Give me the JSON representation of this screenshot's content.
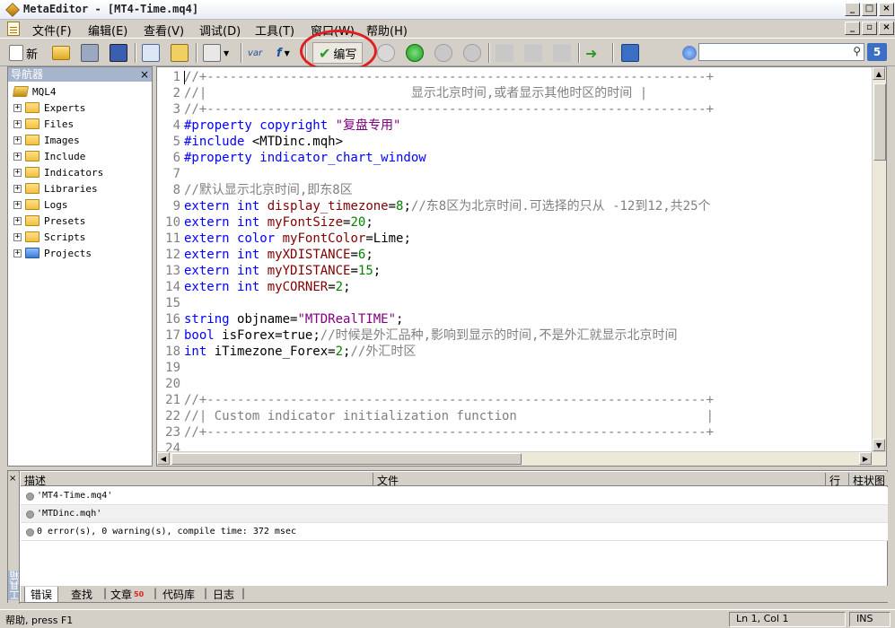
{
  "window": {
    "title": "MetaEditor - [MT4-Time.mq4]"
  },
  "menu": [
    "文件(F)",
    "编辑(E)",
    "查看(V)",
    "调试(D)",
    "工具(T)",
    "窗口(W)",
    "帮助(H)"
  ],
  "toolbar": {
    "new_label": "新",
    "compile_label": "编写",
    "var_label": "var",
    "f_label": "f",
    "search_badge": "5"
  },
  "navigator": {
    "title": "导航器",
    "root": "MQL4",
    "items": [
      "Experts",
      "Files",
      "Images",
      "Include",
      "Indicators",
      "Libraries",
      "Logs",
      "Presets",
      "Scripts",
      "Projects"
    ]
  },
  "editor": {
    "lines": [
      "//+------------------------------------------------------------------+",
      "//|                           显示北京时间,或者显示其他时区的时间 |",
      "//+------------------------------------------------------------------+",
      "#property copyright \"复盘专用\"",
      "#include <MTDinc.mqh>",
      "#property indicator_chart_window",
      "",
      "//默认显示北京时间,即东8区",
      "extern int display_timezone=8;//东8区为北京时间.可选择的只从 -12到12,共25个",
      "extern int myFontSize=20;",
      "extern color myFontColor=Lime;",
      "extern int myXDISTANCE=6;",
      "extern int myYDISTANCE=15;",
      "extern int myCORNER=2;",
      "",
      "string objname=\"MTDRealTIME\";",
      "bool isForex=true;//时候是外汇品种,影响到显示的时间,不是外汇就显示北京时间",
      "int iTimezone_Forex=2;//外汇时区",
      "",
      "",
      "//+------------------------------------------------------------------+",
      "//| Custom indicator initialization function                         |",
      "//+------------------------------------------------------------------+",
      ""
    ],
    "line_numbers": [
      "1",
      "2",
      "3",
      "4",
      "5",
      "6",
      "7",
      "8",
      "9",
      "10",
      "11",
      "12",
      "13",
      "14",
      "15",
      "16",
      "17",
      "18",
      "19",
      "20",
      "21",
      "22",
      "23",
      "24"
    ]
  },
  "output": {
    "side_label": "工具箱",
    "columns": {
      "desc": "描述",
      "file": "文件",
      "line": "行",
      "col": "柱状图"
    },
    "rows": [
      "'MT4-Time.mq4'",
      "'MTDinc.mqh'",
      "0 error(s), 0 warning(s), compile time: 372 msec"
    ],
    "tabs": [
      "错误",
      "查找",
      "文章",
      "代码库",
      "日志"
    ],
    "articles_badge": "50"
  },
  "status": {
    "help": "帮助, press F1",
    "position": "Ln 1, Col 1",
    "mode": "INS"
  },
  "colors": {
    "keyword": "#0000ff",
    "comment": "#808080",
    "string": "#800080",
    "identifier": "#800000",
    "number": "#008000",
    "plain": "#000000"
  }
}
